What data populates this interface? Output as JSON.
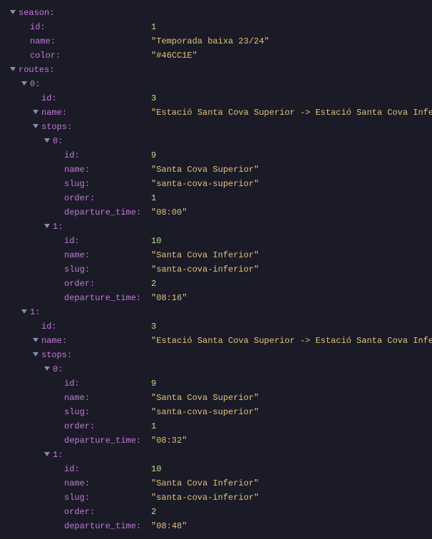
{
  "tree": [
    {
      "depth": 0,
      "toggle": true,
      "key": "season",
      "valueType": null,
      "value": null
    },
    {
      "depth": 1,
      "toggle": false,
      "key": "id",
      "valueType": "num",
      "value": "1"
    },
    {
      "depth": 1,
      "toggle": false,
      "key": "name",
      "valueType": "str",
      "value": "\"Temporada baixa 23/24\""
    },
    {
      "depth": 1,
      "toggle": false,
      "key": "color",
      "valueType": "str",
      "value": "\"#46CC1E\""
    },
    {
      "depth": 0,
      "toggle": true,
      "key": "routes",
      "valueType": null,
      "value": null
    },
    {
      "depth": 1,
      "toggle": true,
      "key": "0",
      "valueType": null,
      "value": null
    },
    {
      "depth": 2,
      "toggle": false,
      "key": "id",
      "valueType": "num",
      "value": "3"
    },
    {
      "depth": 2,
      "toggle": true,
      "key": "name",
      "valueType": "str",
      "value": "\"Estació Santa Cova Superior -> Estació Santa Cova Inferior\""
    },
    {
      "depth": 2,
      "toggle": true,
      "key": "stops",
      "valueType": null,
      "value": null
    },
    {
      "depth": 3,
      "toggle": true,
      "key": "0",
      "valueType": null,
      "value": null
    },
    {
      "depth": 4,
      "toggle": false,
      "key": "id",
      "valueType": "num",
      "value": "9"
    },
    {
      "depth": 4,
      "toggle": false,
      "key": "name",
      "valueType": "str",
      "value": "\"Santa Cova Superior\""
    },
    {
      "depth": 4,
      "toggle": false,
      "key": "slug",
      "valueType": "str",
      "value": "\"santa-cova-superior\""
    },
    {
      "depth": 4,
      "toggle": false,
      "key": "order",
      "valueType": "num",
      "value": "1"
    },
    {
      "depth": 4,
      "toggle": false,
      "key": "departure_time",
      "valueType": "str",
      "value": "\"08:00\""
    },
    {
      "depth": 3,
      "toggle": true,
      "key": "1",
      "valueType": null,
      "value": null
    },
    {
      "depth": 4,
      "toggle": false,
      "key": "id",
      "valueType": "num",
      "value": "10"
    },
    {
      "depth": 4,
      "toggle": false,
      "key": "name",
      "valueType": "str",
      "value": "\"Santa Cova Inferior\""
    },
    {
      "depth": 4,
      "toggle": false,
      "key": "slug",
      "valueType": "str",
      "value": "\"santa-cova-inferior\""
    },
    {
      "depth": 4,
      "toggle": false,
      "key": "order",
      "valueType": "num",
      "value": "2"
    },
    {
      "depth": 4,
      "toggle": false,
      "key": "departure_time",
      "valueType": "str",
      "value": "\"08:16\""
    },
    {
      "depth": 1,
      "toggle": true,
      "key": "1",
      "valueType": null,
      "value": null
    },
    {
      "depth": 2,
      "toggle": false,
      "key": "id",
      "valueType": "num",
      "value": "3"
    },
    {
      "depth": 2,
      "toggle": true,
      "key": "name",
      "valueType": "str",
      "value": "\"Estació Santa Cova Superior -> Estació Santa Cova Inferior\""
    },
    {
      "depth": 2,
      "toggle": true,
      "key": "stops",
      "valueType": null,
      "value": null
    },
    {
      "depth": 3,
      "toggle": true,
      "key": "0",
      "valueType": null,
      "value": null
    },
    {
      "depth": 4,
      "toggle": false,
      "key": "id",
      "valueType": "num",
      "value": "9"
    },
    {
      "depth": 4,
      "toggle": false,
      "key": "name",
      "valueType": "str",
      "value": "\"Santa Cova Superior\""
    },
    {
      "depth": 4,
      "toggle": false,
      "key": "slug",
      "valueType": "str",
      "value": "\"santa-cova-superior\""
    },
    {
      "depth": 4,
      "toggle": false,
      "key": "order",
      "valueType": "num",
      "value": "1"
    },
    {
      "depth": 4,
      "toggle": false,
      "key": "departure_time",
      "valueType": "str",
      "value": "\"08:32\""
    },
    {
      "depth": 3,
      "toggle": true,
      "key": "1",
      "valueType": null,
      "value": null
    },
    {
      "depth": 4,
      "toggle": false,
      "key": "id",
      "valueType": "num",
      "value": "10"
    },
    {
      "depth": 4,
      "toggle": false,
      "key": "name",
      "valueType": "str",
      "value": "\"Santa Cova Inferior\""
    },
    {
      "depth": 4,
      "toggle": false,
      "key": "slug",
      "valueType": "str",
      "value": "\"santa-cova-inferior\""
    },
    {
      "depth": 4,
      "toggle": false,
      "key": "order",
      "valueType": "num",
      "value": "2"
    },
    {
      "depth": 4,
      "toggle": false,
      "key": "departure_time",
      "valueType": "str",
      "value": "\"08:48\""
    }
  ]
}
